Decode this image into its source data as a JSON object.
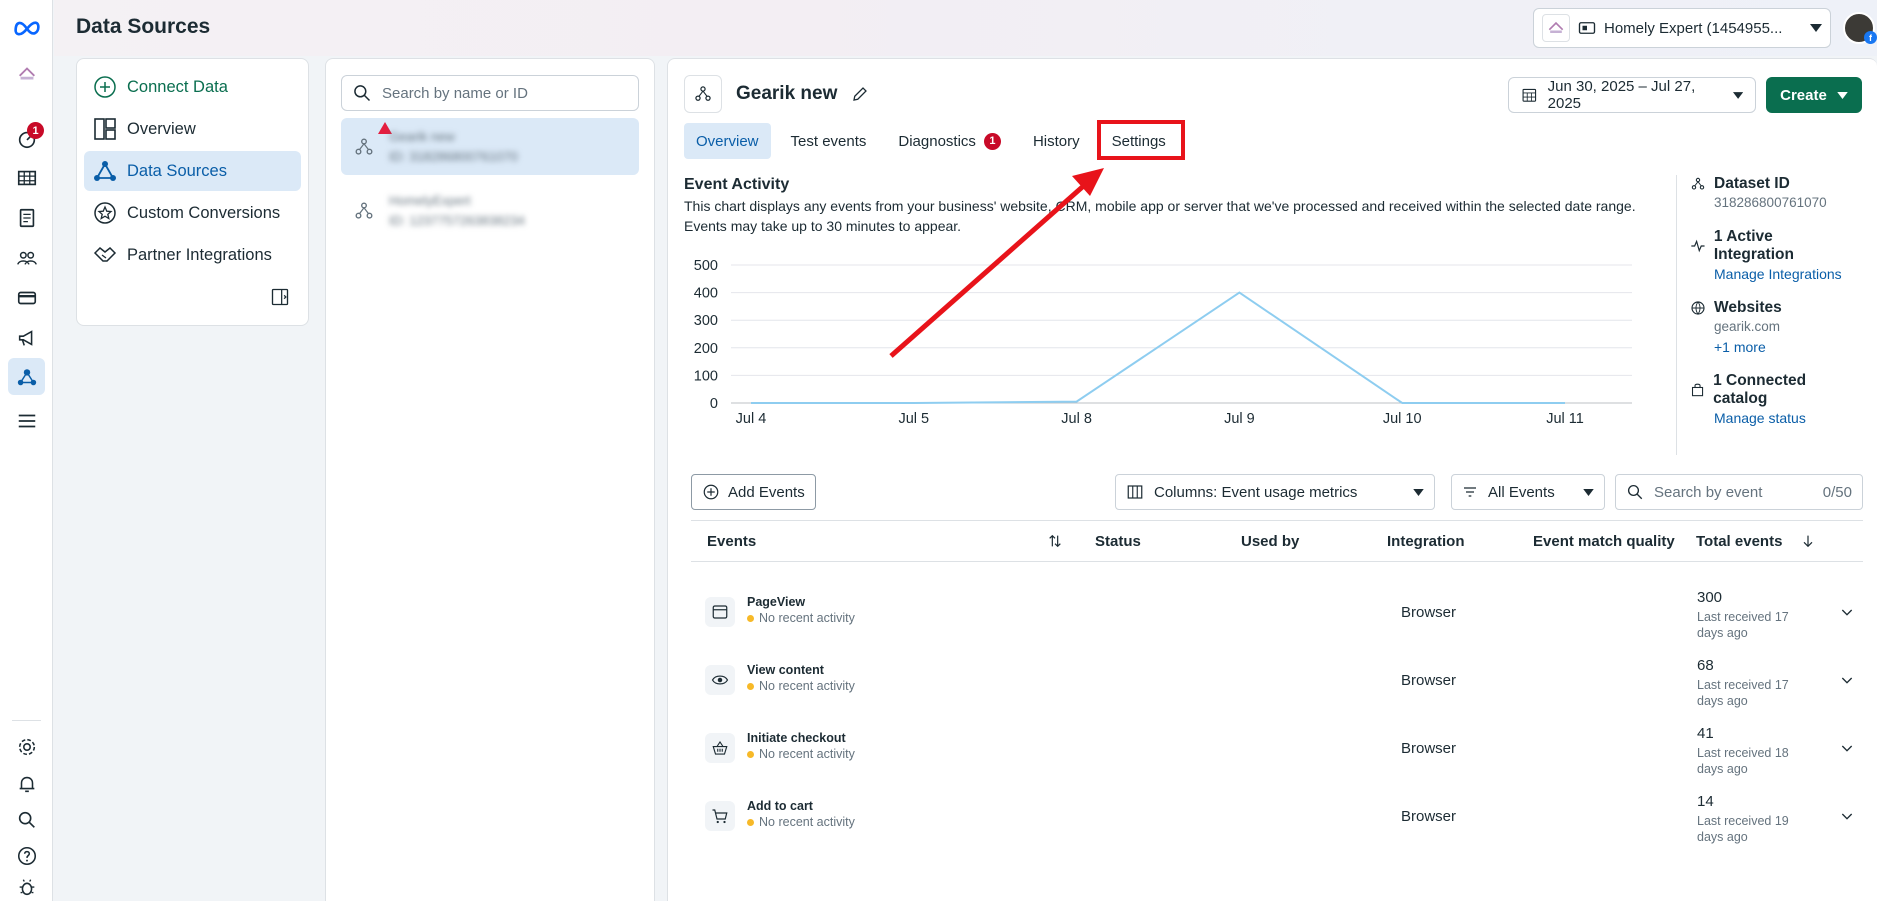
{
  "page": {
    "title": "Data Sources"
  },
  "account": {
    "name": "Homely Expert (1454955..."
  },
  "rail": {
    "notification_badge": "1"
  },
  "nav": {
    "connect": "Connect Data",
    "items": [
      "Overview",
      "Data Sources",
      "Custom Conversions",
      "Partner Integrations"
    ]
  },
  "list": {
    "search_placeholder": "Search by name or ID",
    "sources": [
      {
        "name": "Gearik new",
        "id": "ID: 318286800761070"
      },
      {
        "name": "HomelyExpert",
        "id": "ID: 1237757263838234"
      }
    ]
  },
  "dataset": {
    "name": "Gearik new",
    "date_range": "Jun 30, 2025 – Jul 27, 2025",
    "create": "Create",
    "tabs": [
      "Overview",
      "Test events",
      "Diagnostics",
      "History",
      "Settings"
    ],
    "diagnostics_badge": "1"
  },
  "activity": {
    "title": "Event Activity",
    "desc": "This chart displays any events from your business' website, CRM, mobile app or server that we've processed and received within the selected date range. Events may take up to 30 minutes to appear."
  },
  "chart_data": {
    "type": "line",
    "x": [
      "Jul 4",
      "Jul 5",
      "Jul 8",
      "Jul 9",
      "Jul 10",
      "Jul 11"
    ],
    "values": [
      0,
      0,
      5,
      400,
      0,
      0
    ],
    "yticks": [
      0,
      100,
      200,
      300,
      400,
      500
    ],
    "ylim": [
      0,
      500
    ],
    "color": "#8ecdf0",
    "grid": true
  },
  "side": {
    "dataset_id_label": "Dataset ID",
    "dataset_id": "318286800761070",
    "integration": "1 Active Integration",
    "manage_integrations": "Manage Integrations",
    "websites": "Websites",
    "website": "gearik.com",
    "more": "+1 more",
    "catalog": "1 Connected catalog",
    "manage_status": "Manage status"
  },
  "toolbar": {
    "add_events": "Add Events",
    "columns": "Columns: Event usage metrics",
    "filter": "All Events",
    "search_placeholder": "Search by event",
    "count": "0/50"
  },
  "table": {
    "headers": [
      "Events",
      "Status",
      "Used by",
      "Integration",
      "Event match quality",
      "Total events"
    ],
    "rows": [
      {
        "name": "PageView",
        "activity": "No recent activity",
        "integration": "Browser",
        "total": "300",
        "last": "Last received 17 days ago",
        "icon": "browser-window-icon"
      },
      {
        "name": "View content",
        "activity": "No recent activity",
        "integration": "Browser",
        "total": "68",
        "last": "Last received 17 days ago",
        "icon": "eye-icon"
      },
      {
        "name": "Initiate checkout",
        "activity": "No recent activity",
        "integration": "Browser",
        "total": "41",
        "last": "Last received 18 days ago",
        "icon": "basket-icon"
      },
      {
        "name": "Add to cart",
        "activity": "No recent activity",
        "integration": "Browser",
        "total": "14",
        "last": "Last received 19 days ago",
        "icon": "cart-icon"
      }
    ]
  }
}
